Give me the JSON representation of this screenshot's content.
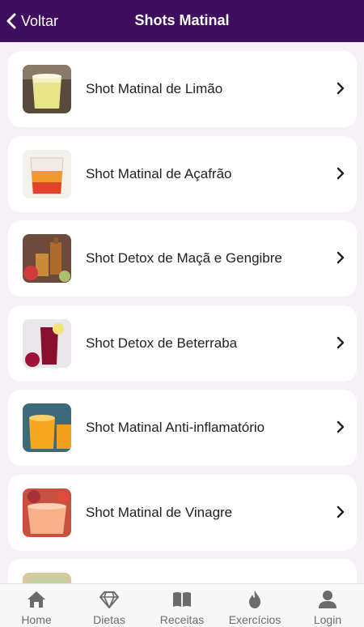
{
  "header": {
    "back_label": "Voltar",
    "title": "Shots Matinal"
  },
  "items": [
    {
      "label": "Shot Matinal de Limão"
    },
    {
      "label": "Shot Matinal de Açafrão"
    },
    {
      "label": "Shot Detox de Maçã e Gengibre"
    },
    {
      "label": "Shot Detox de Beterraba"
    },
    {
      "label": "Shot Matinal Anti-inflamatório"
    },
    {
      "label": "Shot Matinal de Vinagre"
    }
  ],
  "tabs": [
    {
      "label": "Home",
      "icon": "home-icon"
    },
    {
      "label": "Dietas",
      "icon": "diamond-icon"
    },
    {
      "label": "Receitas",
      "icon": "book-icon"
    },
    {
      "label": "Exercícios",
      "icon": "flame-icon"
    },
    {
      "label": "Login",
      "icon": "user-icon"
    }
  ],
  "colors": {
    "header_bg": "#3d0f5e",
    "page_bg": "#f5f1f7",
    "tab_icon": "#6b6b6b"
  }
}
